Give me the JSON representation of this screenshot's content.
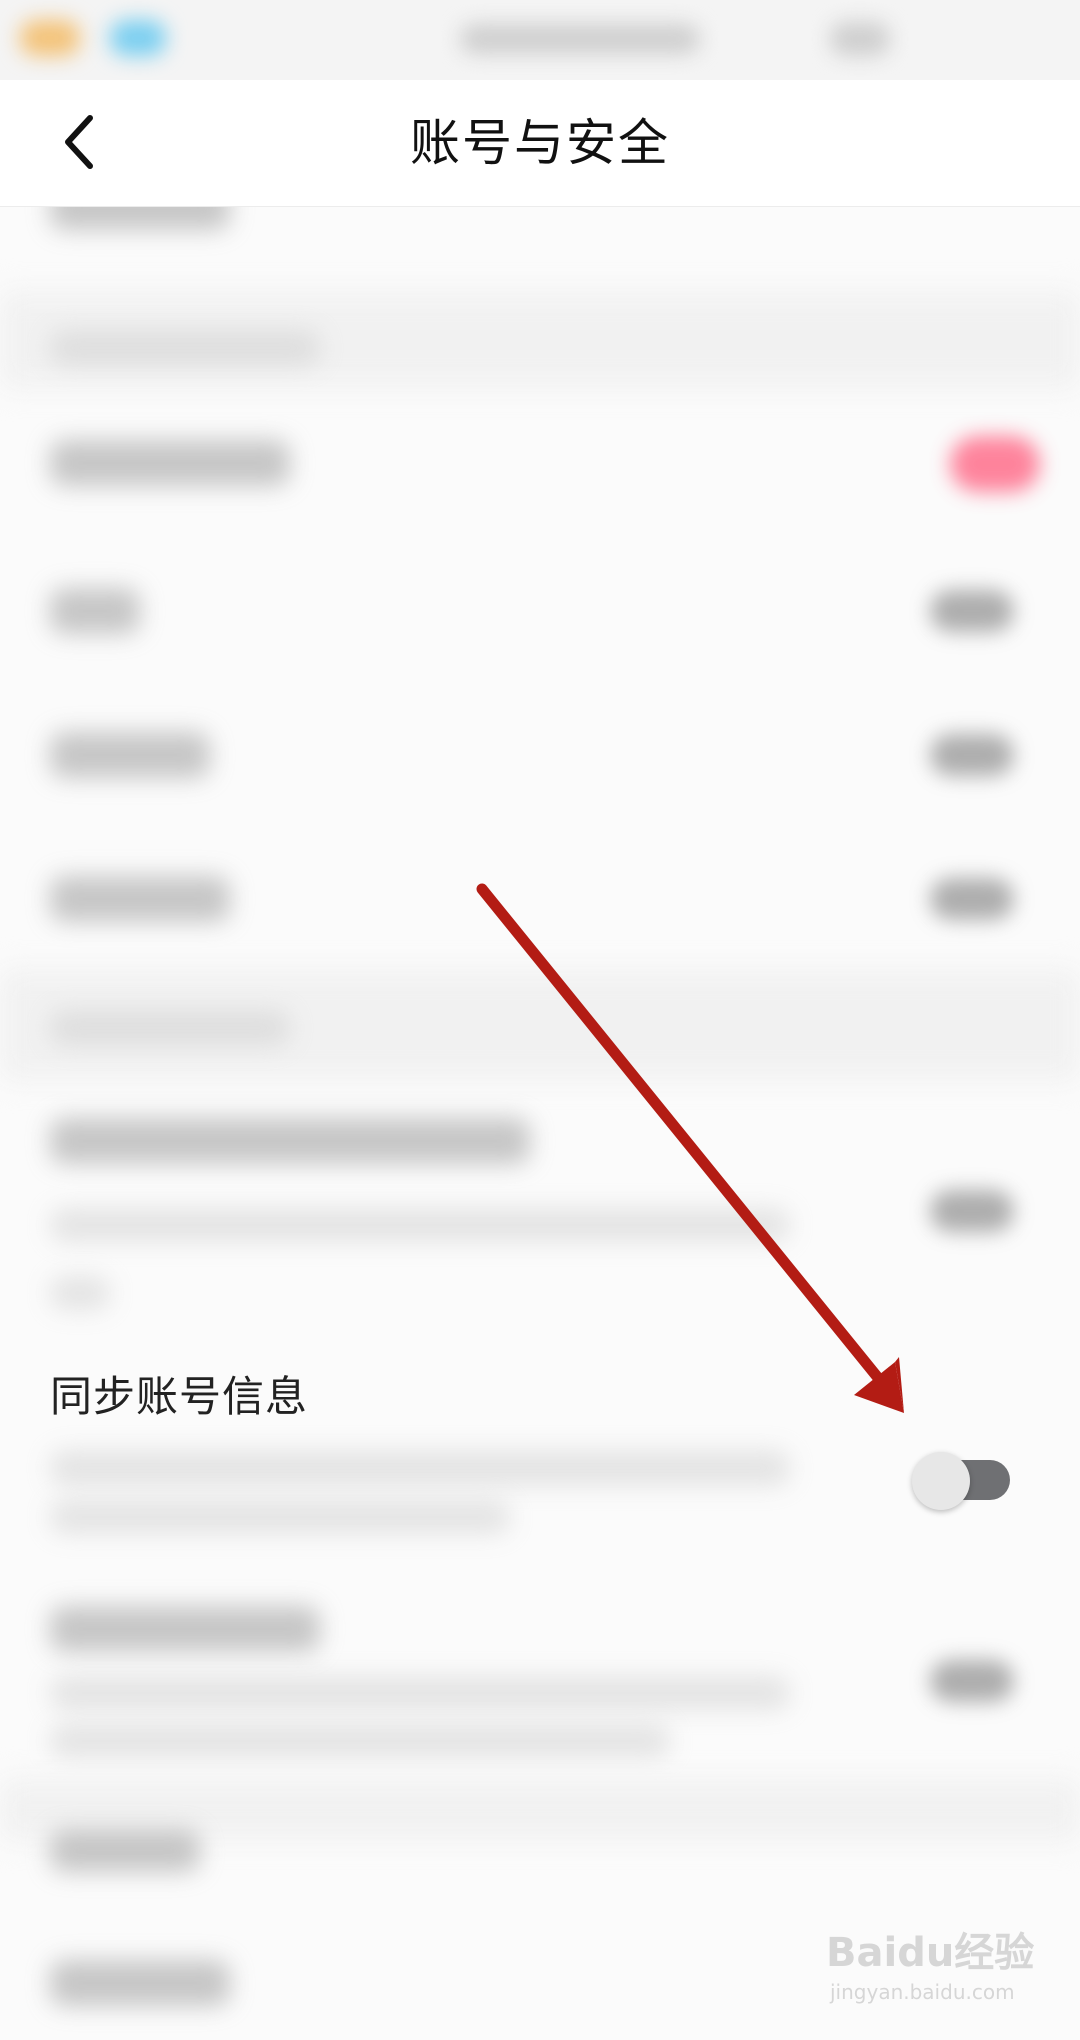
{
  "header": {
    "title": "账号与安全",
    "back_icon": "chevron-left-icon"
  },
  "sync_row": {
    "title": "同步账号信息",
    "toggle_state": "off"
  },
  "colors": {
    "toggle_off_track": "#6f7073",
    "toggle_knob": "#e7e7e7",
    "annotation_arrow": "#b31c14"
  },
  "watermark": {
    "brand": "Baidu经验",
    "url": "jingyan.baidu.com"
  }
}
